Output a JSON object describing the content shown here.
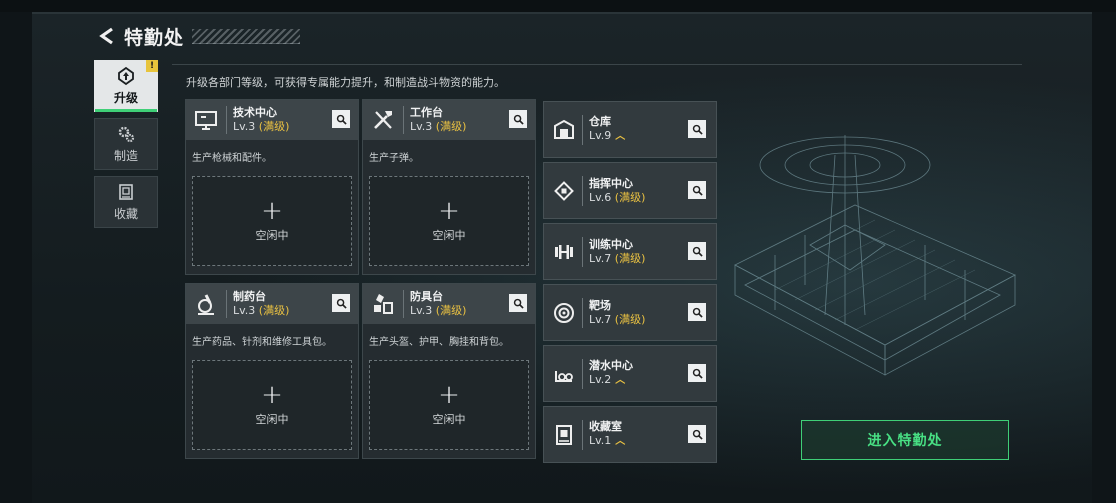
{
  "header": {
    "title": "特勤处"
  },
  "tabs": [
    {
      "label": "升级",
      "active": true,
      "badge": "!"
    },
    {
      "label": "制造",
      "active": false
    },
    {
      "label": "收藏",
      "active": false
    }
  ],
  "description": "升级各部门等级，可获得专属能力提升，和制造战斗物资的能力。",
  "max_label": "(满级)",
  "idle_label": "空闲中",
  "big_cards": [
    {
      "name": "技术中心",
      "level": "Lv.3",
      "desc": "生产枪械和配件。",
      "icon": "monitor-icon"
    },
    {
      "name": "工作台",
      "level": "Lv.3",
      "desc": "生产子弹。",
      "icon": "tools-icon"
    },
    {
      "name": "制药台",
      "level": "Lv.3",
      "desc": "生产药品、针剂和维修工具包。",
      "icon": "microscope-icon"
    },
    {
      "name": "防具台",
      "level": "Lv.3",
      "desc": "生产头盔、护甲、胸挂和背包。",
      "icon": "armor-icon"
    }
  ],
  "small_cards": [
    {
      "name": "仓库",
      "level": "Lv.9",
      "status": "upgradable",
      "icon": "warehouse-icon"
    },
    {
      "name": "指挥中心",
      "level": "Lv.6",
      "status": "max",
      "icon": "chip-icon"
    },
    {
      "name": "训练中心",
      "level": "Lv.7",
      "status": "max",
      "icon": "dumbbell-icon"
    },
    {
      "name": "靶场",
      "level": "Lv.7",
      "status": "max",
      "icon": "target-icon"
    },
    {
      "name": "潜水中心",
      "level": "Lv.2",
      "status": "upgradable",
      "icon": "diving-mask-icon"
    },
    {
      "name": "收藏室",
      "level": "Lv.1",
      "status": "upgradable",
      "icon": "collection-icon"
    }
  ],
  "enter_button": "进入特勤处",
  "colors": {
    "accent_green": "#3fcf77",
    "max_gold": "#e9c142",
    "badge_yellow": "#e7c43c"
  }
}
